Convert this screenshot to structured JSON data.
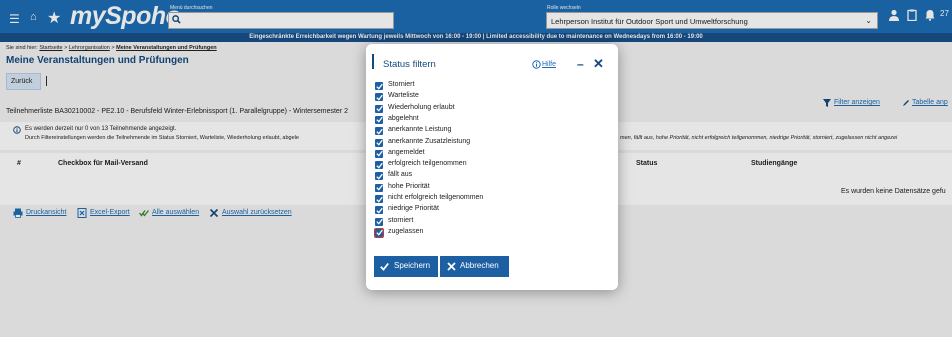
{
  "header": {
    "logo": "mySpoho",
    "menu_label": "Menü durchsuchen",
    "role_label": "Rolle wechseln",
    "role_value": "Lehrperson Institut für Outdoor Sport und Umweltforschung",
    "notification_count": "27"
  },
  "banner": "Eingeschränkte Erreichbarkeit wegen Wartung jeweils Mittwoch von 16:00 - 19:00 | Limited accessibility due to maintenance on Wednesdays from 16:00 - 19:00",
  "breadcrumb": {
    "prefix": "Sie sind hier:",
    "items": [
      "Startseite",
      "Lehrorganisation",
      "Meine Veranstaltungen und Prüfungen"
    ]
  },
  "page_title": "Meine Veranstaltungen und Prüfungen",
  "back_label": "Zurück",
  "course": "Teilnehmerliste BA30210002 - PE2.10 - Berufsfeld Winter-Erlebnissport (1. Parallelgruppe) - Wintersemester 2",
  "filter_show": "Filter anzeigen",
  "table_link": "Tabelle anp",
  "info": {
    "line1": "Es werden derzeit nur 0 von 13 Teilnehmende angezeigt.",
    "line2": "Durch Filtereinstellungen werden die Teilnehmende im Status Storniert, Warteliste, Wiederholung erlaubt, abgele",
    "line2_tail": "men, fällt aus, hohe Priorität, nicht erfolgreich teilgenommen, niedrige Priorität, storniert, zugelassen nicht angezei"
  },
  "table": {
    "headers": [
      "#",
      "Checkbox für Mail-Versand",
      "Status",
      "Studiengänge"
    ],
    "empty": "Es wurden keine Datensätze gefu"
  },
  "actions": [
    "Druckansicht",
    "Excel-Export",
    "Alle auswählen",
    "Auswahl zurücksetzen"
  ],
  "modal": {
    "title": "Status filtern",
    "help": "Hilfe",
    "options": [
      "Storniert",
      "Warteliste",
      "Wiederholung erlaubt",
      "abgelehnt",
      "anerkannte Leistung",
      "anerkannte Zusatzleistung",
      "angemeldet",
      "erfolgreich teilgenommen",
      "fällt aus",
      "hohe Priorität",
      "nicht erfolgreich teilgenommen",
      "niedrige Priorität",
      "storniert",
      "zugelassen"
    ],
    "save": "Speichern",
    "cancel": "Abbrechen"
  }
}
